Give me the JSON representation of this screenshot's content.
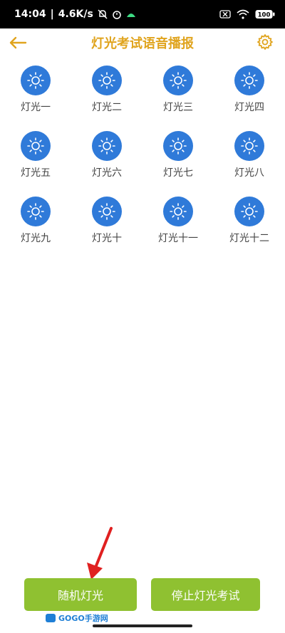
{
  "status_bar": {
    "time": "14:04",
    "network_speed": "4.6K/s",
    "battery": "100"
  },
  "header": {
    "title": "灯光考试语音播报",
    "accent_color": "#e0a41e"
  },
  "lights": [
    {
      "label": "灯光一"
    },
    {
      "label": "灯光二"
    },
    {
      "label": "灯光三"
    },
    {
      "label": "灯光四"
    },
    {
      "label": "灯光五"
    },
    {
      "label": "灯光六"
    },
    {
      "label": "灯光七"
    },
    {
      "label": "灯光八"
    },
    {
      "label": "灯光九"
    },
    {
      "label": "灯光十"
    },
    {
      "label": "灯光十一"
    },
    {
      "label": "灯光十二"
    }
  ],
  "buttons": {
    "random_label": "随机灯光",
    "stop_label": "停止灯光考试",
    "color": "#8fc131"
  },
  "watermark": {
    "text": "GOGO手游网"
  },
  "icons": {
    "back": "back-arrow-icon",
    "settings": "gear-icon",
    "light": "sun-icon"
  }
}
